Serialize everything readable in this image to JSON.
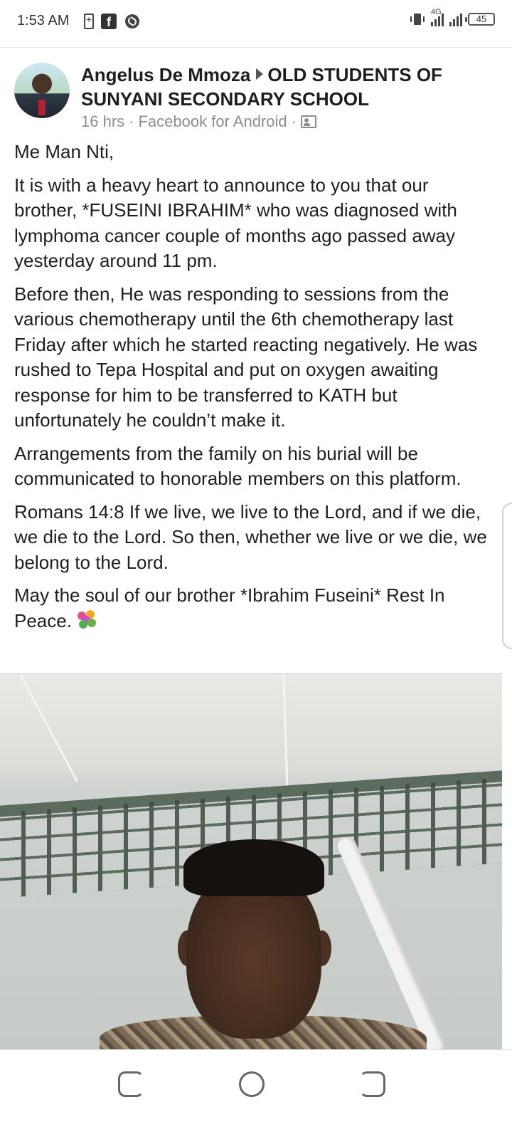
{
  "status_bar": {
    "time": "1:53 AM",
    "network_label": "4G",
    "battery_level": "45",
    "icons": [
      "battery-charging-icon",
      "facebook-icon",
      "shazam-icon",
      "vibrate-icon",
      "signal-icon",
      "signal-icon"
    ]
  },
  "post": {
    "author": "Angelus De Mmoza",
    "group": "OLD STUDENTS OF SUNYANI SECONDARY SCHOOL",
    "time_ago": "16 hrs",
    "source": "Facebook for Android",
    "separator": "·",
    "privacy_icon": "group-icon",
    "paragraphs": [
      "Me Man Nti,",
      "It is with a heavy heart to announce to you that our brother, *FUSEINI IBRAHIM* who was diagnosed with lymphoma cancer couple of months ago passed away yesterday around 11 pm.",
      "Before then, He was responding to sessions from the various chemotherapy until the 6th chemotherapy last Friday after which he started reacting negatively. He was rushed to Tepa Hospital and put on oxygen awaiting response for him to be transferred to KATH but unfortunately he couldn’t make it.",
      "Arrangements from the family on his burial will be communicated to honorable members on this platform.",
      "Romans 14:8 If we live, we live to the Lord, and if we die, we die to the Lord. So then, whether we live or we die, we belong to the Lord."
    ],
    "last_paragraph": "May the soul of our brother *Ibrahim Fuseini* Rest In Peace.",
    "emoji": "bouquet-icon"
  },
  "navigation": {
    "buttons": [
      "recent-apps-button",
      "home-button",
      "back-button"
    ]
  }
}
